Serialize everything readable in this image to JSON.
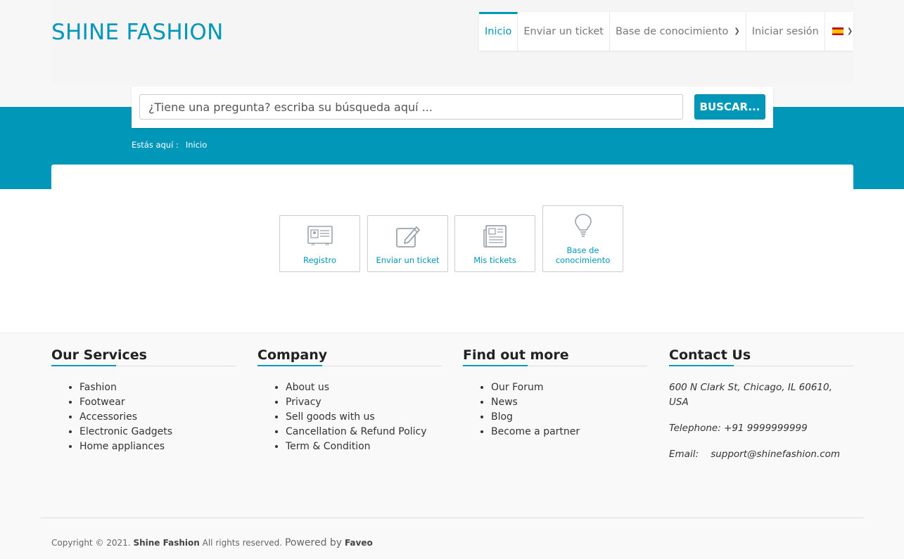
{
  "header": {
    "logo": "SHINE FASHION",
    "nav": [
      {
        "label": "Inicio",
        "active": true
      },
      {
        "label": "Enviar un ticket"
      },
      {
        "label": "Base de conocimiento"
      },
      {
        "label": "Iniciar sesión"
      }
    ],
    "language_icon": "spain-flag-icon"
  },
  "search": {
    "placeholder": "¿Tiene una pregunta? escriba su búsqueda aquí ...",
    "button": "BUSCAR..."
  },
  "breadcrumb": {
    "prefix": "Estás aquí :",
    "current": "Inicio"
  },
  "tiles": [
    {
      "label": "Registro",
      "icon": "id-card-icon"
    },
    {
      "label": "Enviar un ticket",
      "icon": "edit-icon"
    },
    {
      "label": "Mis tickets",
      "icon": "newspaper-icon"
    },
    {
      "label_line1": "Base de",
      "label_line2": "conocimiento",
      "icon": "lightbulb-icon"
    }
  ],
  "footer": {
    "services": {
      "title": "Our Services",
      "items": [
        "Fashion",
        "Footwear",
        "Accessories",
        "Electronic Gadgets",
        "Home appliances"
      ]
    },
    "company": {
      "title": "Company",
      "items": [
        "About us",
        "Privacy",
        "Sell goods with us",
        "Cancellation & Refund Policy",
        "Term & Condition"
      ]
    },
    "find": {
      "title": "Find out more",
      "items": [
        "Our Forum",
        "News",
        "Blog",
        "Become a partner"
      ]
    },
    "contact": {
      "title": "Contact Us",
      "address": "600 N Clark St, Chicago, IL 60610, USA",
      "phone": "Telephone: +91 9999999999",
      "email_label": "Email:",
      "email": "support@shinefashion.com"
    },
    "copyright": {
      "prefix": "Copyright © 2021.",
      "company": "Shine Fashion",
      "rights": "All rights reserved.",
      "powered": "Powered by",
      "product": "Faveo"
    }
  },
  "colors": {
    "accent": "#0097b8"
  }
}
